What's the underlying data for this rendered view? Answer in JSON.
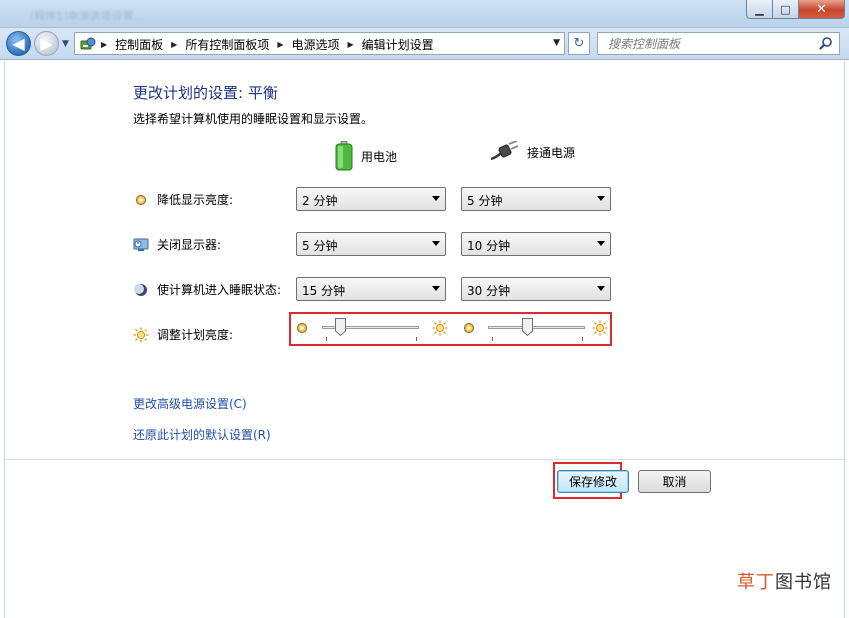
{
  "window": {
    "minimize_glyph": "▁",
    "maximize_glyph": "□",
    "close_glyph": "✕",
    "ghost_title": "[程序1]电源选项设置..."
  },
  "nav": {
    "back_glyph": "◀",
    "forward_glyph": "▶",
    "dropdown_glyph": "▼",
    "refresh_glyph": "↻"
  },
  "breadcrumb": {
    "separator": "▶",
    "items": [
      "控制面板",
      "所有控制面板项",
      "电源选项",
      "编辑计划设置"
    ]
  },
  "search": {
    "placeholder": "搜索控制面板"
  },
  "page": {
    "title": "更改计划的设置: 平衡",
    "description": "选择希望计算机使用的睡眠设置和显示设置。"
  },
  "columns": {
    "battery": "用电池",
    "plugged": "接通电源"
  },
  "settings": {
    "dim_display": {
      "label": "降低显示亮度:",
      "battery": "2 分钟",
      "plugged": "5 分钟"
    },
    "turn_off_display": {
      "label": "关闭显示器:",
      "battery": "5 分钟",
      "plugged": "10 分钟"
    },
    "sleep": {
      "label": "使计算机进入睡眠状态:",
      "battery": "15 分钟",
      "plugged": "30 分钟"
    },
    "brightness": {
      "label": "调整计划亮度:",
      "battery_level": 0.15,
      "plugged_level": 0.4
    }
  },
  "links": {
    "advanced": "更改高级电源设置(C)",
    "restore": "还原此计划的默认设置(R)"
  },
  "buttons": {
    "save": "保存修改",
    "cancel": "取消"
  },
  "watermark": {
    "accent": "草丁",
    "rest": "图书馆"
  },
  "colors": {
    "title": "#1e3287",
    "link": "#1f4fa8",
    "highlight": "#e0282f"
  }
}
